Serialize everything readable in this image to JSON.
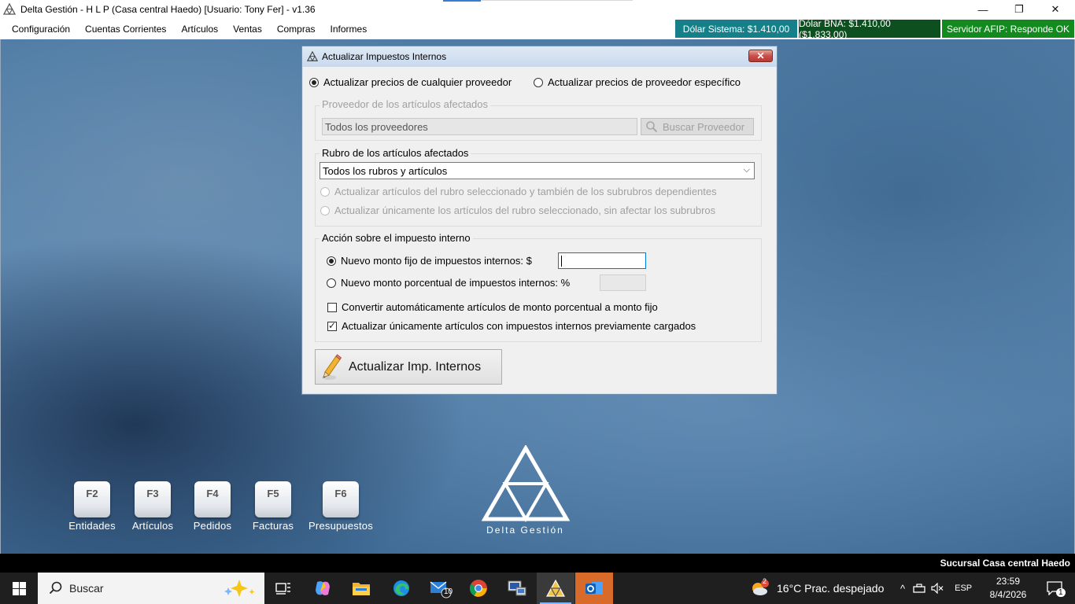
{
  "window": {
    "title": "Delta Gestión - H L P (Casa central Haedo) [Usuario: Tony Fer] - v1.36",
    "minimize": "—",
    "maximize": "❐",
    "close": "✕"
  },
  "menu": {
    "items": [
      "Configuración",
      "Cuentas Corrientes",
      "Artículos",
      "Ventas",
      "Compras",
      "Informes"
    ]
  },
  "status": {
    "dolar_sistema": "Dólar Sistema: $1.410,00",
    "dolar_bna": "Dólar BNA: $1.410,00 ($1.833,00)",
    "afip": "Servidor AFIP:  Responde OK",
    "colors": {
      "teal": "#16808a",
      "dark_green": "#0d4f1f",
      "green": "#138a1e"
    }
  },
  "dialog": {
    "title": "Actualizar Impuestos Internos",
    "close_label": "✕",
    "scope": {
      "any_supplier": "Actualizar precios de cualquier proveedor",
      "specific_supplier": "Actualizar precios de proveedor específico",
      "selected": "any_supplier"
    },
    "supplier_group": {
      "caption": "Proveedor de los artículos afectados",
      "value": "Todos los proveedores",
      "search_button": "Buscar Proveedor"
    },
    "category_group": {
      "caption": "Rubro de los artículos afectados",
      "selected_value": "Todos los rubros y artículos",
      "option_with_children": "Actualizar artículos del rubro seleccionado y también de los subrubros dependientes",
      "option_only_selected": "Actualizar únicamente los artículos del rubro seleccionado, sin afectar los subrubros"
    },
    "action_group": {
      "caption": "Acción sobre el impuesto interno",
      "fixed_amount_label": "Nuevo monto fijo de impuestos internos: $",
      "fixed_amount_value": "",
      "percent_label": "Nuevo monto porcentual de impuestos internos: %",
      "percent_value": "",
      "selected": "fixed",
      "convert_label": "Convertir automáticamente artículos de monto porcentual a monto fijo",
      "convert_checked": false,
      "only_loaded_label": "Actualizar únicamente artículos con impuestos internos previamente cargados",
      "only_loaded_checked": true
    },
    "submit_button": "Actualizar Imp. Internos"
  },
  "shortcuts": [
    {
      "key": "F2",
      "label": "Entidades"
    },
    {
      "key": "F3",
      "label": "Artículos"
    },
    {
      "key": "F4",
      "label": "Pedidos"
    },
    {
      "key": "F5",
      "label": "Facturas"
    },
    {
      "key": "F6",
      "label": "Presupuestos"
    }
  ],
  "brand": {
    "text": "Delta Gestión"
  },
  "statusline": {
    "branch": "Sucursal Casa central Haedo"
  },
  "taskbar": {
    "search_label": "Buscar",
    "mail_badge": "10",
    "weather_badge": "2",
    "weather": "16°C  Prac. despejado",
    "language": "ESP",
    "time": "23:59",
    "date": "8/4/2026",
    "notification_count": "1",
    "apps": [
      "task-view",
      "copilot",
      "file-explorer",
      "edge",
      "mail",
      "chrome",
      "remote-app",
      "delta-gestion",
      "outlook"
    ]
  }
}
